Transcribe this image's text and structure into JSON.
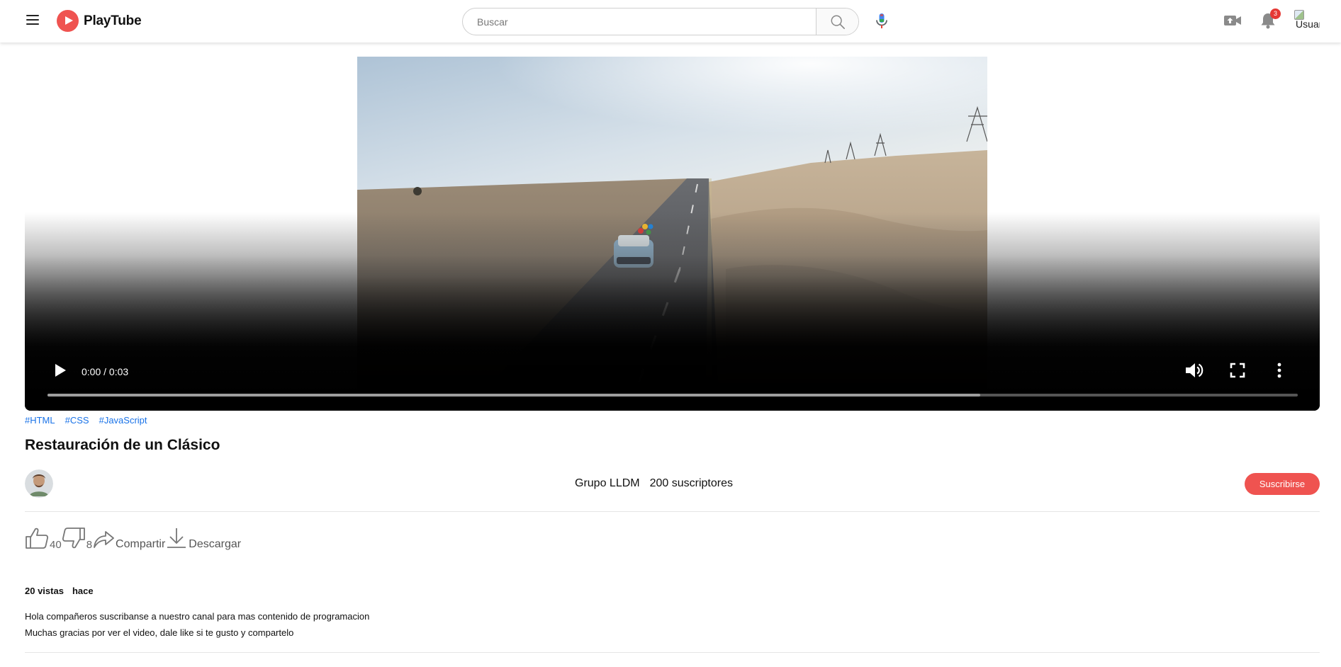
{
  "header": {
    "logo_text": "PlayTube",
    "search_placeholder": "Buscar",
    "notification_count": "3",
    "avatar_alt": "Usuario",
    "icons": [
      "menu-icon",
      "play-logo-icon",
      "search-icon",
      "microphone-icon",
      "upload-video-icon",
      "bell-icon"
    ]
  },
  "video": {
    "time": "0:00 / 0:03",
    "progress": 0,
    "buffered": 0.746,
    "icons": [
      "play-icon",
      "volume-icon",
      "fullscreen-icon",
      "more-vertical-icon"
    ]
  },
  "tags": [
    "#HTML",
    "#CSS",
    "#JavaScript"
  ],
  "title": "Restauración de un Clásico",
  "channel": {
    "name": "Grupo LLDM",
    "subscribers": "200 suscriptores",
    "subscribe_label": "Suscribirse",
    "accent_color": "#ef5350"
  },
  "actions": {
    "likes": "40",
    "dislikes": "8",
    "share_label": "Compartir",
    "download_label": "Descargar"
  },
  "stats": {
    "views": "20 vistas",
    "date": "hace"
  },
  "description": {
    "line1": "Hola compañeros suscribanse a nuestro canal para mas contenido de programacion",
    "line2": "Muchas gracias por ver el video, dale like si te gusto y compartelo"
  }
}
